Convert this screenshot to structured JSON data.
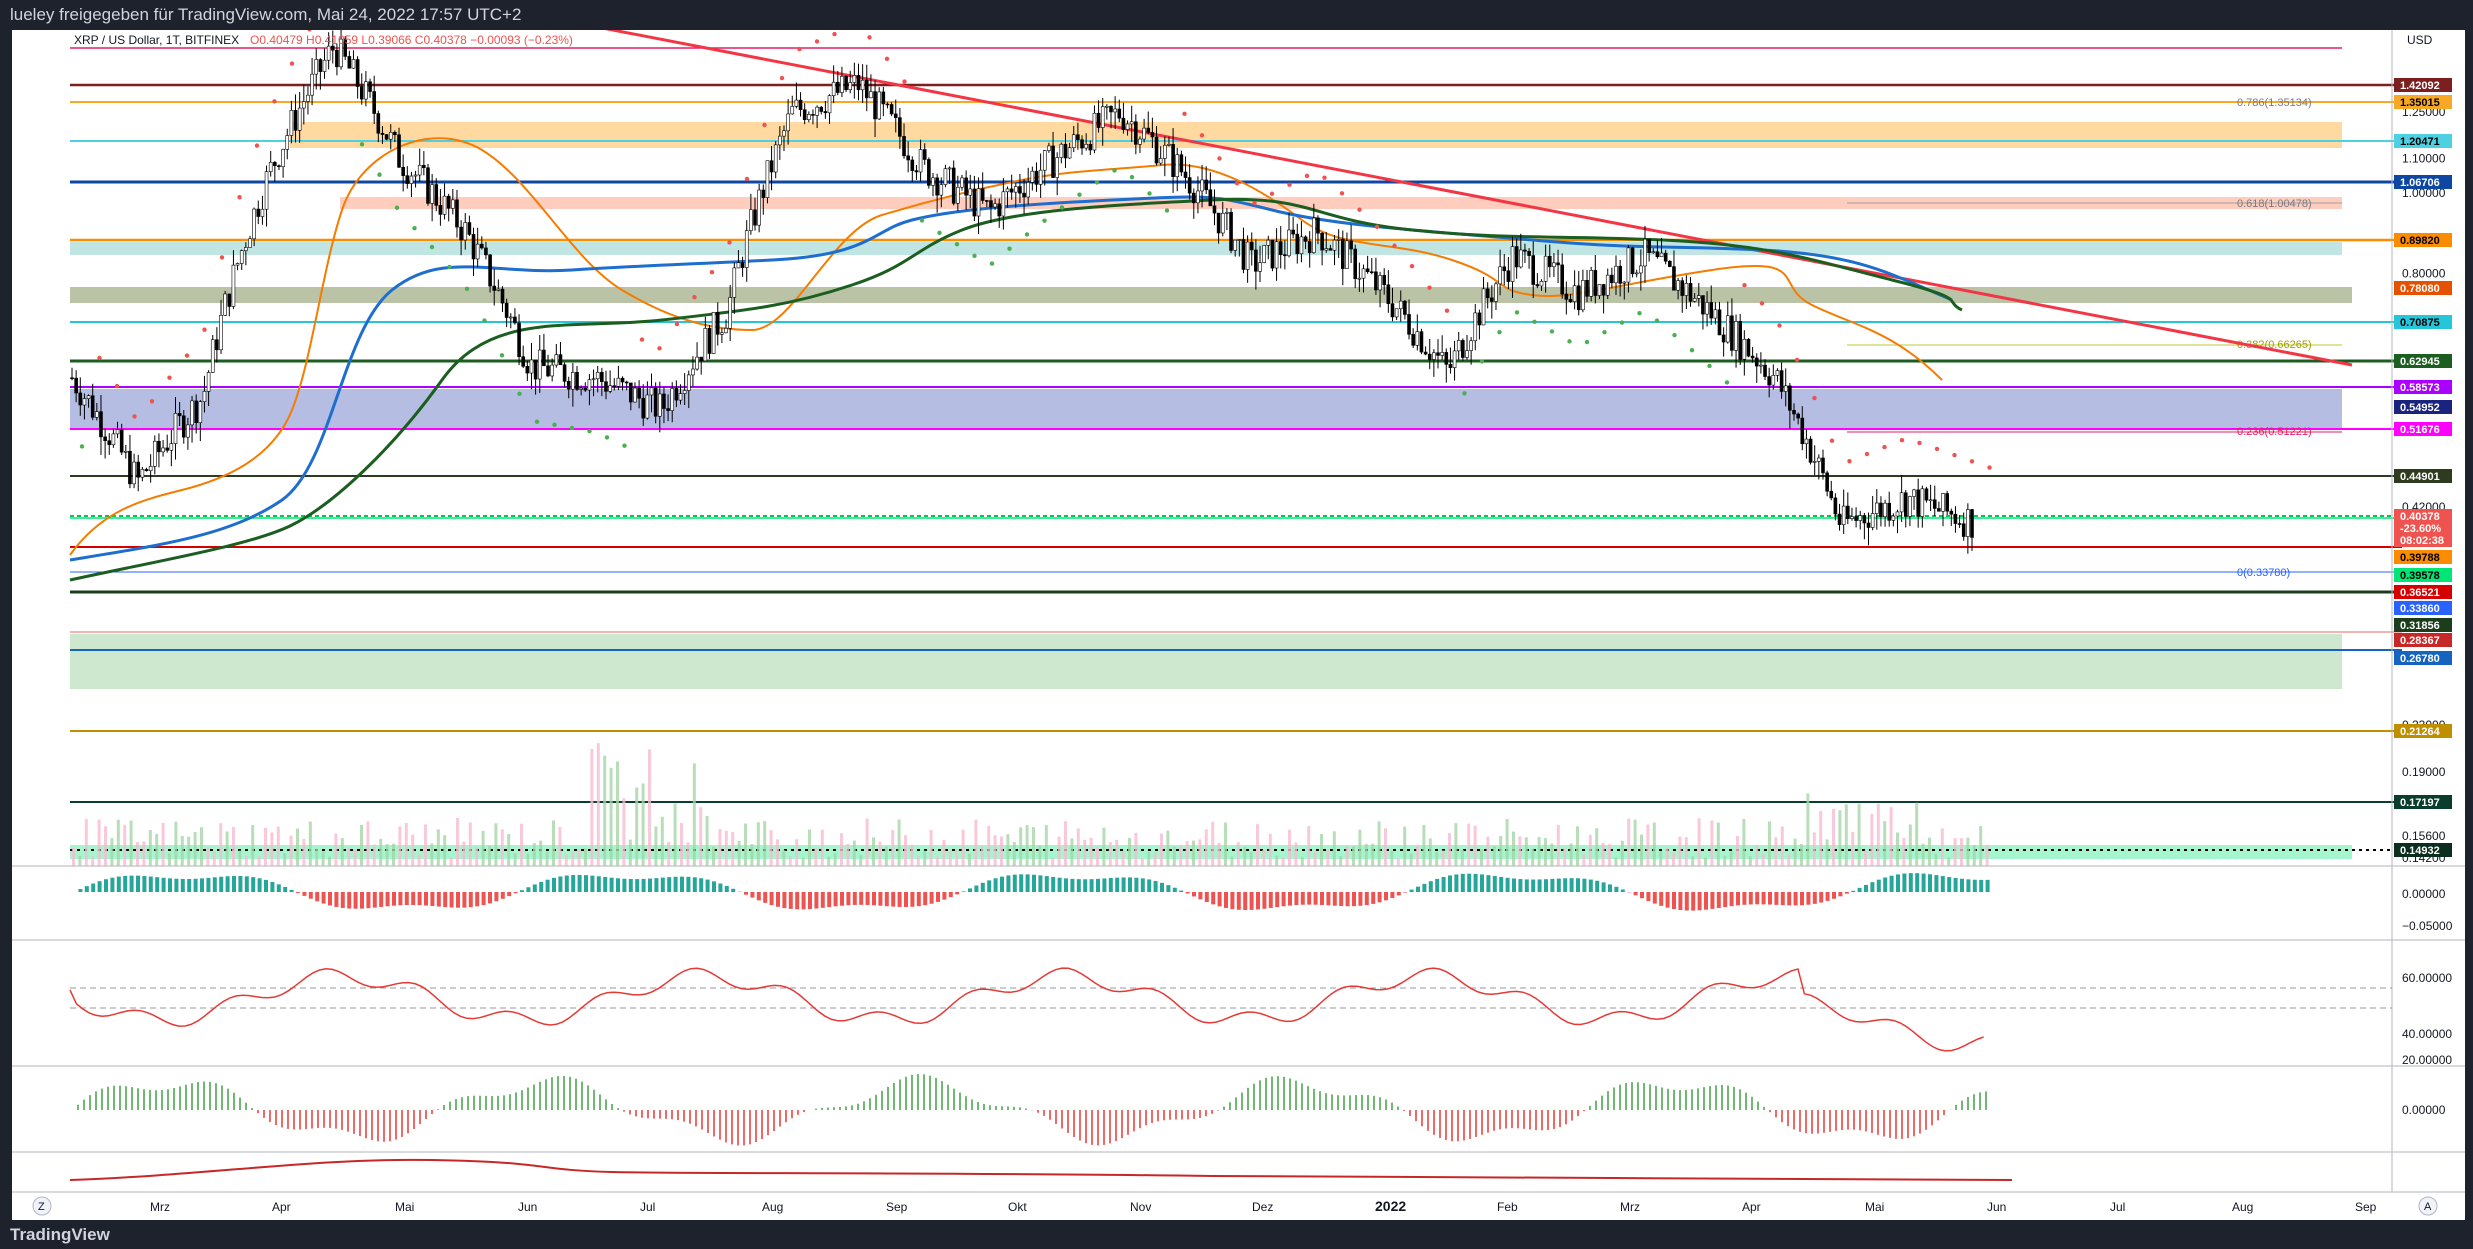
{
  "header": {
    "publisher": "lueley freigegeben für TradingView.com, Mai 24, 2022 17:57 UTC+2",
    "symbol_line": "XRP / US Dollar, 1T, BITFINEX",
    "ohlc": "O0.40479 H0.41059 L0.39066 C0.40378 −0.00093 (−0.23%)"
  },
  "footer": {
    "brand": "TradingView"
  },
  "colors": {
    "up": "#26a69a",
    "down": "#ef5350",
    "trendline": "#f23645",
    "ma_blue": "#1e6ecf",
    "ma_green": "#1b5e20",
    "ma_orange": "#f57c00"
  },
  "chart_data": {
    "type": "candlestick",
    "currency_label": "USD",
    "x_ticks": [
      "Mrz",
      "Apr",
      "Mai",
      "Jun",
      "Jul",
      "Aug",
      "Sep",
      "Okt",
      "Nov",
      "Dez",
      "2022",
      "Feb",
      "Mrz",
      "Apr",
      "Mai",
      "Jun",
      "Jul",
      "Aug",
      "Sep"
    ],
    "y_ticks": [
      "1.25000",
      "1.10000",
      "1.00000",
      "0.80000",
      "0.42000",
      "0.23000",
      "0.19000",
      "0.15600",
      "0.14200"
    ],
    "price_path": [
      {
        "x": "Feb 2021",
        "y": 0.6
      },
      {
        "x": "Mrz",
        "y": 0.45
      },
      {
        "x": "Apr",
        "y": 0.57
      },
      {
        "x": "Apr",
        "y": 1.05
      },
      {
        "x": "Mai",
        "y": 1.5
      },
      {
        "x": "Mai",
        "y": 1.1
      },
      {
        "x": "Jun",
        "y": 0.9
      },
      {
        "x": "Jun",
        "y": 0.62
      },
      {
        "x": "Jul",
        "y": 0.6
      },
      {
        "x": "Jul",
        "y": 0.55
      },
      {
        "x": "Aug",
        "y": 0.72
      },
      {
        "x": "Aug",
        "y": 1.25
      },
      {
        "x": "Sep",
        "y": 1.35
      },
      {
        "x": "Sep",
        "y": 1.07
      },
      {
        "x": "Okt",
        "y": 0.95
      },
      {
        "x": "Okt",
        "y": 1.1
      },
      {
        "x": "Nov",
        "y": 1.25
      },
      {
        "x": "Nov",
        "y": 1.05
      },
      {
        "x": "Dez",
        "y": 0.82
      },
      {
        "x": "Dez",
        "y": 0.9
      },
      {
        "x": "2022",
        "y": 0.76
      },
      {
        "x": "2022",
        "y": 0.61
      },
      {
        "x": "Feb",
        "y": 0.84
      },
      {
        "x": "Mrz",
        "y": 0.76
      },
      {
        "x": "Apr",
        "y": 0.84
      },
      {
        "x": "Apr",
        "y": 0.72
      },
      {
        "x": "Mai",
        "y": 0.6
      },
      {
        "x": "Mai",
        "y": 0.4
      },
      {
        "x": "Mai",
        "y": 0.43
      },
      {
        "x": "Mai",
        "y": 0.40378
      }
    ],
    "price_labels": [
      {
        "text": "1.42092",
        "bg": "#7b1f1f",
        "fg": "#ffffff"
      },
      {
        "text": "1.35015",
        "bg": "#f9a825",
        "fg": "#000000"
      },
      {
        "text": "1.20471",
        "bg": "#4dd0e1",
        "fg": "#000000"
      },
      {
        "text": "1.06706",
        "bg": "#0d47a1",
        "fg": "#ffffff"
      },
      {
        "text": "0.89820",
        "bg": "#fb8c00",
        "fg": "#000000"
      },
      {
        "text": "0.78080",
        "bg": "#e65100",
        "fg": "#ffffff"
      },
      {
        "text": "0.70875",
        "bg": "#26c6da",
        "fg": "#000000"
      },
      {
        "text": "0.62945",
        "bg": "#1b5e20",
        "fg": "#ffffff"
      },
      {
        "text": "0.58573",
        "bg": "#aa00ff",
        "fg": "#ffffff"
      },
      {
        "text": "0.54952",
        "bg": "#1a237e",
        "fg": "#ffffff"
      },
      {
        "text": "0.51676",
        "bg": "#ff00ff",
        "fg": "#ffffff"
      },
      {
        "text": "0.44901",
        "bg": "#2e3b1f",
        "fg": "#ffffff"
      },
      {
        "text": "0.40378",
        "bg": "#ef5350",
        "fg": "#ffffff"
      },
      {
        "text": "-23.60%",
        "bg": "#ef5350",
        "fg": "#ffffff"
      },
      {
        "text": "08:02:38",
        "bg": "#ef5350",
        "fg": "#ffffff"
      },
      {
        "text": "0.39788",
        "bg": "#fb8c00",
        "fg": "#000000"
      },
      {
        "text": "0.39578",
        "bg": "#00e676",
        "fg": "#000000"
      },
      {
        "text": "0.36521",
        "bg": "#d50000",
        "fg": "#ffffff"
      },
      {
        "text": "0.33860",
        "bg": "#2962ff",
        "fg": "#ffffff"
      },
      {
        "text": "0.31856",
        "bg": "#1b3d1b",
        "fg": "#ffffff"
      },
      {
        "text": "0.28367",
        "bg": "#c62828",
        "fg": "#ffffff"
      },
      {
        "text": "0.26780",
        "bg": "#1565c0",
        "fg": "#ffffff"
      },
      {
        "text": "0.21264",
        "bg": "#bf8f00",
        "fg": "#ffffff"
      },
      {
        "text": "0.17197",
        "bg": "#0b3d2e",
        "fg": "#ffffff"
      },
      {
        "text": "0.14932",
        "bg": "#0b2e1e",
        "fg": "#ffffff"
      }
    ],
    "fib_labels": [
      "0.786(1.35134)",
      "0.618(1.00478)",
      "0.382(0.66265)",
      "0.236(0.51221)",
      "0(0.33780)"
    ],
    "macd_ticks": [
      "0.00000",
      "−0.05000"
    ],
    "rsi_ticks": [
      "60.00000",
      "40.00000",
      "20.00000"
    ],
    "osc_ticks": [
      "0.00000"
    ],
    "pane_buttons": [
      "Z",
      "A"
    ]
  }
}
